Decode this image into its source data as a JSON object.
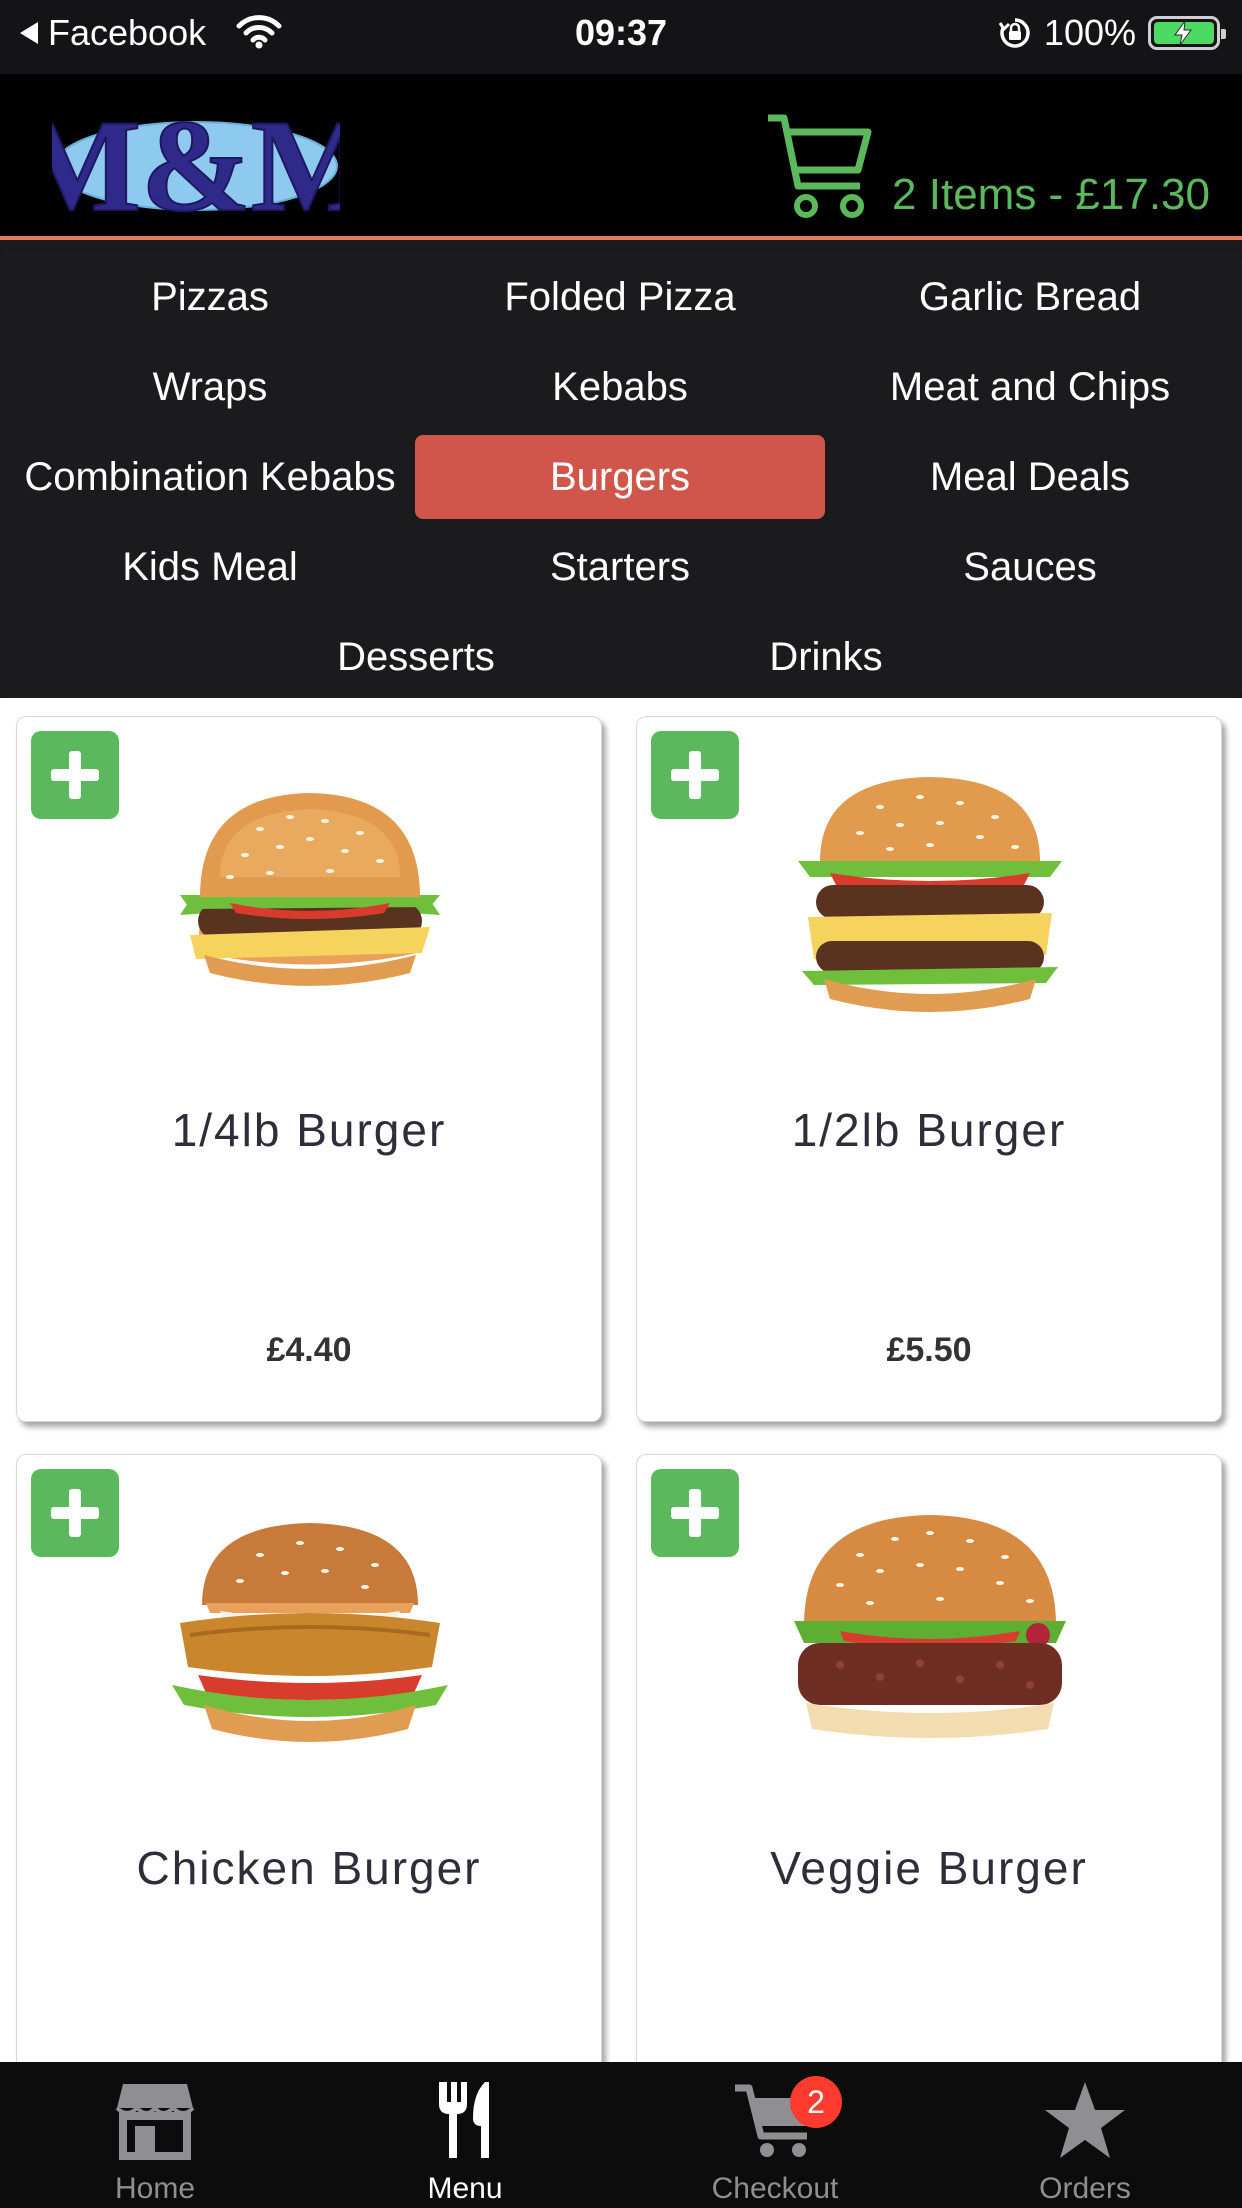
{
  "status_bar": {
    "back_app": "Facebook",
    "time": "09:37",
    "battery_pct": "100%"
  },
  "header": {
    "logo_text": "M&M",
    "cart_summary": "2 Items - £17.30"
  },
  "categories": {
    "rows": [
      [
        "Pizzas",
        "Folded Pizza",
        "Garlic Bread"
      ],
      [
        "Wraps",
        "Kebabs",
        "Meat and Chips"
      ],
      [
        "Combination Kebabs",
        "Burgers",
        "Meal Deals"
      ],
      [
        "Kids Meal",
        "Starters",
        "Sauces"
      ],
      [
        "Desserts",
        "Drinks"
      ]
    ],
    "active": "Burgers"
  },
  "products": [
    {
      "name": "1/4lb Burger",
      "price": "£4.40",
      "image": "single-patty-burger"
    },
    {
      "name": "1/2lb Burger",
      "price": "£5.50",
      "image": "double-patty-burger"
    },
    {
      "name": "Chicken Burger",
      "price": "",
      "image": "chicken-burger"
    },
    {
      "name": "Veggie Burger",
      "price": "",
      "image": "veggie-burger"
    }
  ],
  "tabbar": {
    "items": [
      {
        "label": "Home",
        "icon": "store-icon"
      },
      {
        "label": "Menu",
        "icon": "cutlery-icon"
      },
      {
        "label": "Checkout",
        "icon": "cart-icon"
      },
      {
        "label": "Orders",
        "icon": "star-icon"
      }
    ],
    "active": "Menu",
    "checkout_badge": "2"
  },
  "colors": {
    "accent_green": "#5cb85c",
    "active_category": "#d0564b",
    "badge_red": "#ff3b30",
    "header_border": "#e07a5f"
  }
}
